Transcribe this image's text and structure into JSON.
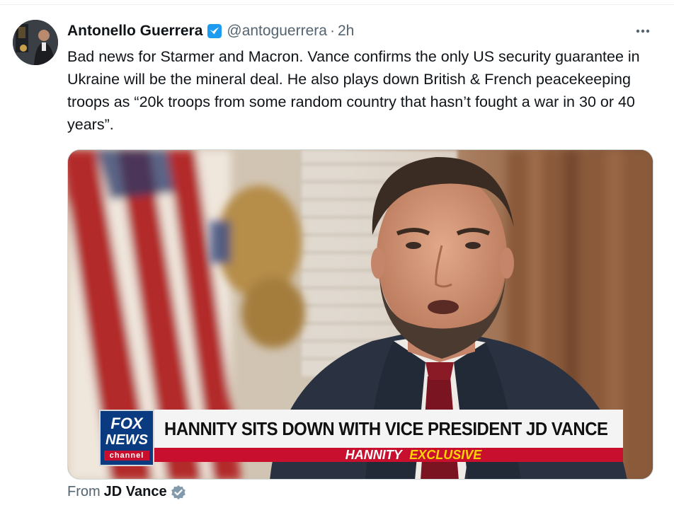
{
  "author": {
    "display_name": "Antonello Guerrera",
    "handle": "@antoguerrera",
    "separator": "·",
    "time": "2h"
  },
  "tweet": {
    "text": "Bad news for Starmer and Macron. Vance confirms the only US security guarantee in Ukraine will be the mineral deal. He also plays down British & French peacekeeping troops as “20k troops from some random country that hasn’t fought a war in 30 or 40 years”."
  },
  "media": {
    "network_logo_top": "FOX",
    "network_logo_mid": "NEWS",
    "network_logo_bottom": "channel",
    "headline": "HANNITY SITS DOWN WITH VICE PRESIDENT JD VANCE",
    "subline_1": "HANNITY",
    "subline_2": "EXCLUSIVE"
  },
  "source": {
    "label": "From",
    "name": "JD Vance"
  },
  "icons": {
    "verified": "verified-badge-icon",
    "more": "more-options-icon",
    "source_verified": "gray-verified-badge-icon"
  },
  "colors": {
    "verified_blue": "#1d9bf0",
    "secondary_text": "#536471",
    "fox_red": "#c8102e",
    "fox_blue": "#0a3a80",
    "exclusive_yellow": "#ffd400"
  }
}
